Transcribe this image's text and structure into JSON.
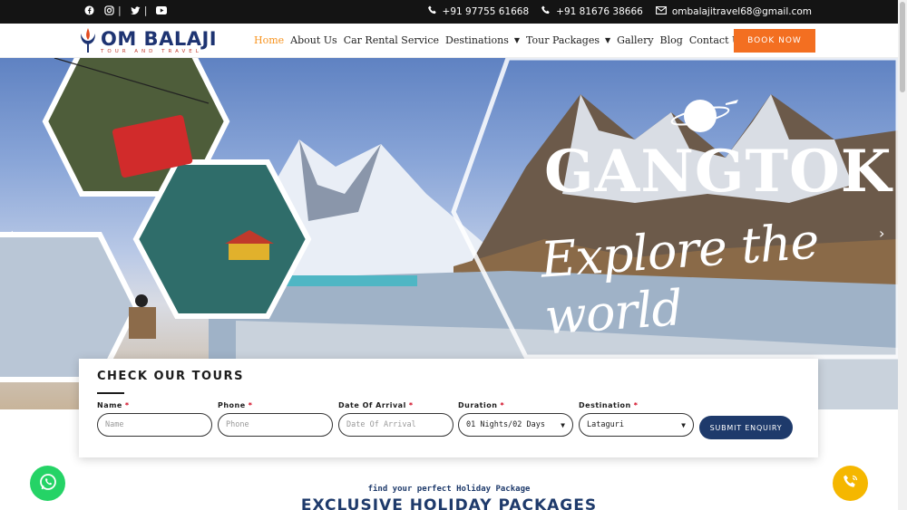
{
  "topbar": {
    "social_icons": [
      "facebook-icon",
      "instagram-icon",
      "twitter-icon",
      "youtube-icon"
    ],
    "phone1": "+91 97755 61668",
    "phone2": "+91 81676 38666",
    "email": "ombalajitravel68@gmail.com"
  },
  "brand": {
    "name": "OM BALAJI",
    "tagline": "TOUR AND TRAVEL"
  },
  "nav": {
    "items": [
      "Home",
      "About Us",
      "Car Rental Service",
      "Destinations",
      "Tour Packages",
      "Gallery",
      "Blog",
      "Contact Us"
    ],
    "book_now": "BOOK NOW"
  },
  "hero": {
    "title": "GANGTOK",
    "script": "Explore the world",
    "prev": "‹",
    "next": "›"
  },
  "enquiry": {
    "title": "CHECK OUR TOURS",
    "name_label": "Name",
    "name_placeholder": "Name",
    "phone_label": "Phone",
    "phone_placeholder": "Phone",
    "date_label": "Date Of Arrival",
    "date_placeholder": "Date Of Arrival",
    "duration_label": "Duration",
    "duration_value": "01 Nights/02 Days",
    "destination_label": "Destination",
    "destination_value": "Lataguri",
    "required_mark": "*",
    "submit": "SUBMIT ENQUIRY"
  },
  "section": {
    "kicker": "find your perfect Holiday Package",
    "heading": "EXCLUSIVE HOLIDAY PACKAGES"
  },
  "colors": {
    "accent_orange": "#f36f21",
    "navy": "#1e3a6b",
    "active_link": "#f7931e",
    "whatsapp": "#25d366",
    "call": "#f5b700"
  }
}
